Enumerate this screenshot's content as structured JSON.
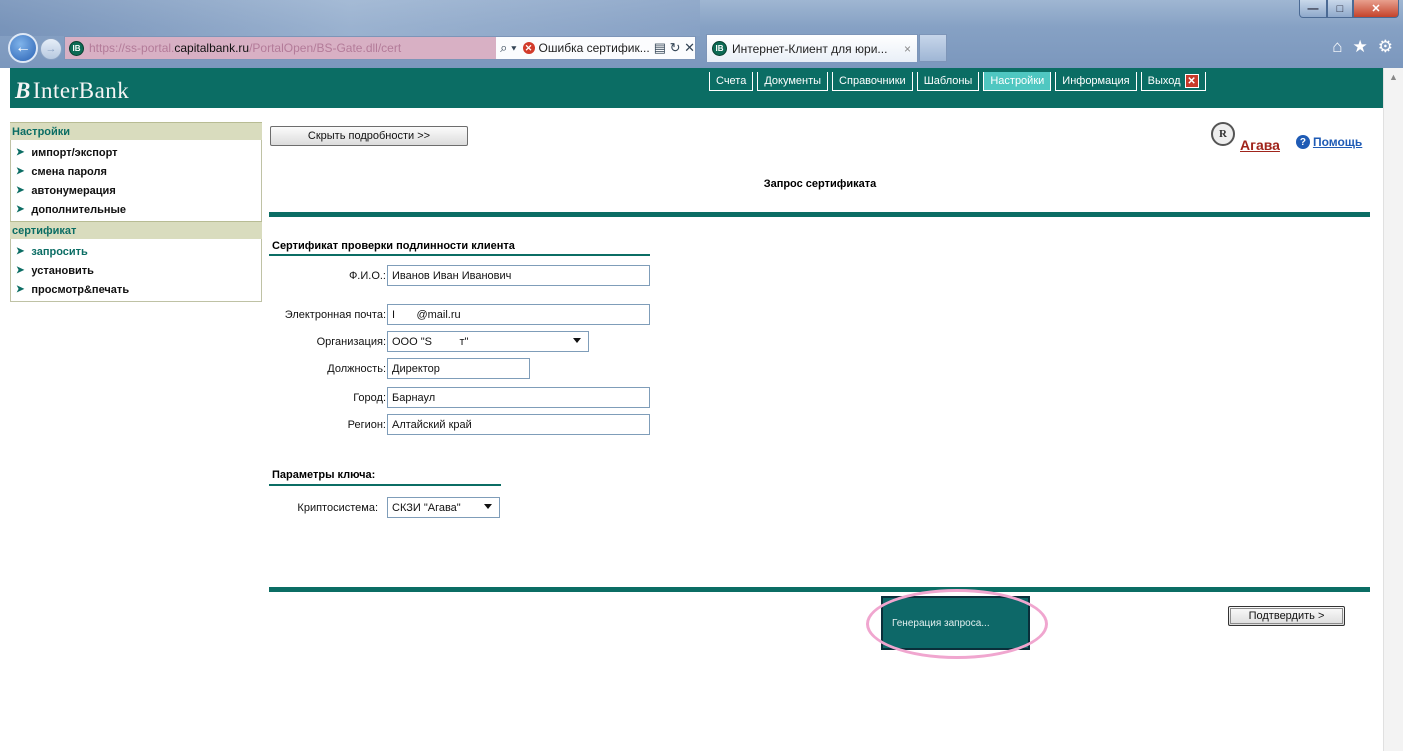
{
  "browser": {
    "url_scheme_dim": "https://ss-portal.",
    "url_host": "capitalbank.ru",
    "url_path_dim": "/PortalOpen/BS-Gate.dll/cert",
    "address_icons": "⌕ ▾",
    "cert_error_label": "Ошибка сертифик...",
    "address_right_icons": "▤ ↻ ✕",
    "tab_title": "Интернет-Клиент для юри...",
    "tab_close": "×",
    "favicon_text": "IB"
  },
  "app": {
    "logo_mark": "B",
    "logo_text": "InterBank"
  },
  "topnav": [
    {
      "label": "Счета",
      "active": false
    },
    {
      "label": "Документы",
      "active": false
    },
    {
      "label": "Справочники",
      "active": false
    },
    {
      "label": "Шаблоны",
      "active": false
    },
    {
      "label": "Настройки",
      "active": true
    },
    {
      "label": "Информация",
      "active": false
    },
    {
      "label": "Выход",
      "active": false
    }
  ],
  "sidebar": {
    "section1_title": "Настройки",
    "section1_items": [
      "импорт/экспорт",
      "смена пароля",
      "автонумерация",
      "дополнительные"
    ],
    "section2_title": "сертификат",
    "section2_items": [
      "запросить",
      "установить",
      "просмотр&печать"
    ]
  },
  "main": {
    "hide_details_label": "Скрыть подробности >>",
    "user_name": "Агава",
    "user_seal": "R",
    "help_label": "Помощь",
    "help_icon": "?",
    "page_title": "Запрос сертификата",
    "cert_section_title": "Сертификат проверки подлинности клиента",
    "fields": {
      "fio_label": "Ф.И.О.:",
      "fio_value": "Иванов Иван Иванович",
      "email_label": "Электронная почта:",
      "email_value": "I       @mail.ru",
      "org_label": "Организация:",
      "org_value": "ООО \"Ѕ         т\"",
      "position_label": "Должность:",
      "position_value": "Директор",
      "city_label": "Город:",
      "city_value": "Барнаул",
      "region_label": "Регион:",
      "region_value": "Алтайский край"
    },
    "key_section_title": "Параметры ключа:",
    "crypto_label": "Криптосистема:",
    "crypto_value": "СКЗИ \"Агава\"",
    "generating_text": "Генерация запроса...",
    "confirm_label": "Подтвердить >"
  },
  "colors": {
    "brand_teal": "#0b6d64",
    "active_tab": "#4fc7c1",
    "sidebar_header": "#d9dcbe",
    "user_link": "#a0241b",
    "highlight_ellipse": "#f0a6cf"
  }
}
